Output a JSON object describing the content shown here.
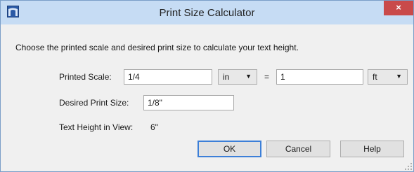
{
  "window": {
    "title": "Print Size Calculator",
    "close_label": "×",
    "icon": "chief-architect-app-icon"
  },
  "instructions": "Choose the printed scale and desired print size to calculate your text height.",
  "printed_scale": {
    "label": "Printed Scale:",
    "value": "1/4",
    "unit": "in",
    "equals": "=",
    "real_value": "1",
    "real_unit": "ft"
  },
  "desired_print_size": {
    "label": "Desired Print Size:",
    "value": "1/8\""
  },
  "text_height": {
    "label": "Text Height in View:",
    "value": "6\""
  },
  "buttons": {
    "ok": "OK",
    "cancel": "Cancel",
    "help": "Help"
  },
  "colors": {
    "titlebar": "#c6dcf4",
    "close": "#c94a4a",
    "default_button_border": "#3c7fd8"
  }
}
